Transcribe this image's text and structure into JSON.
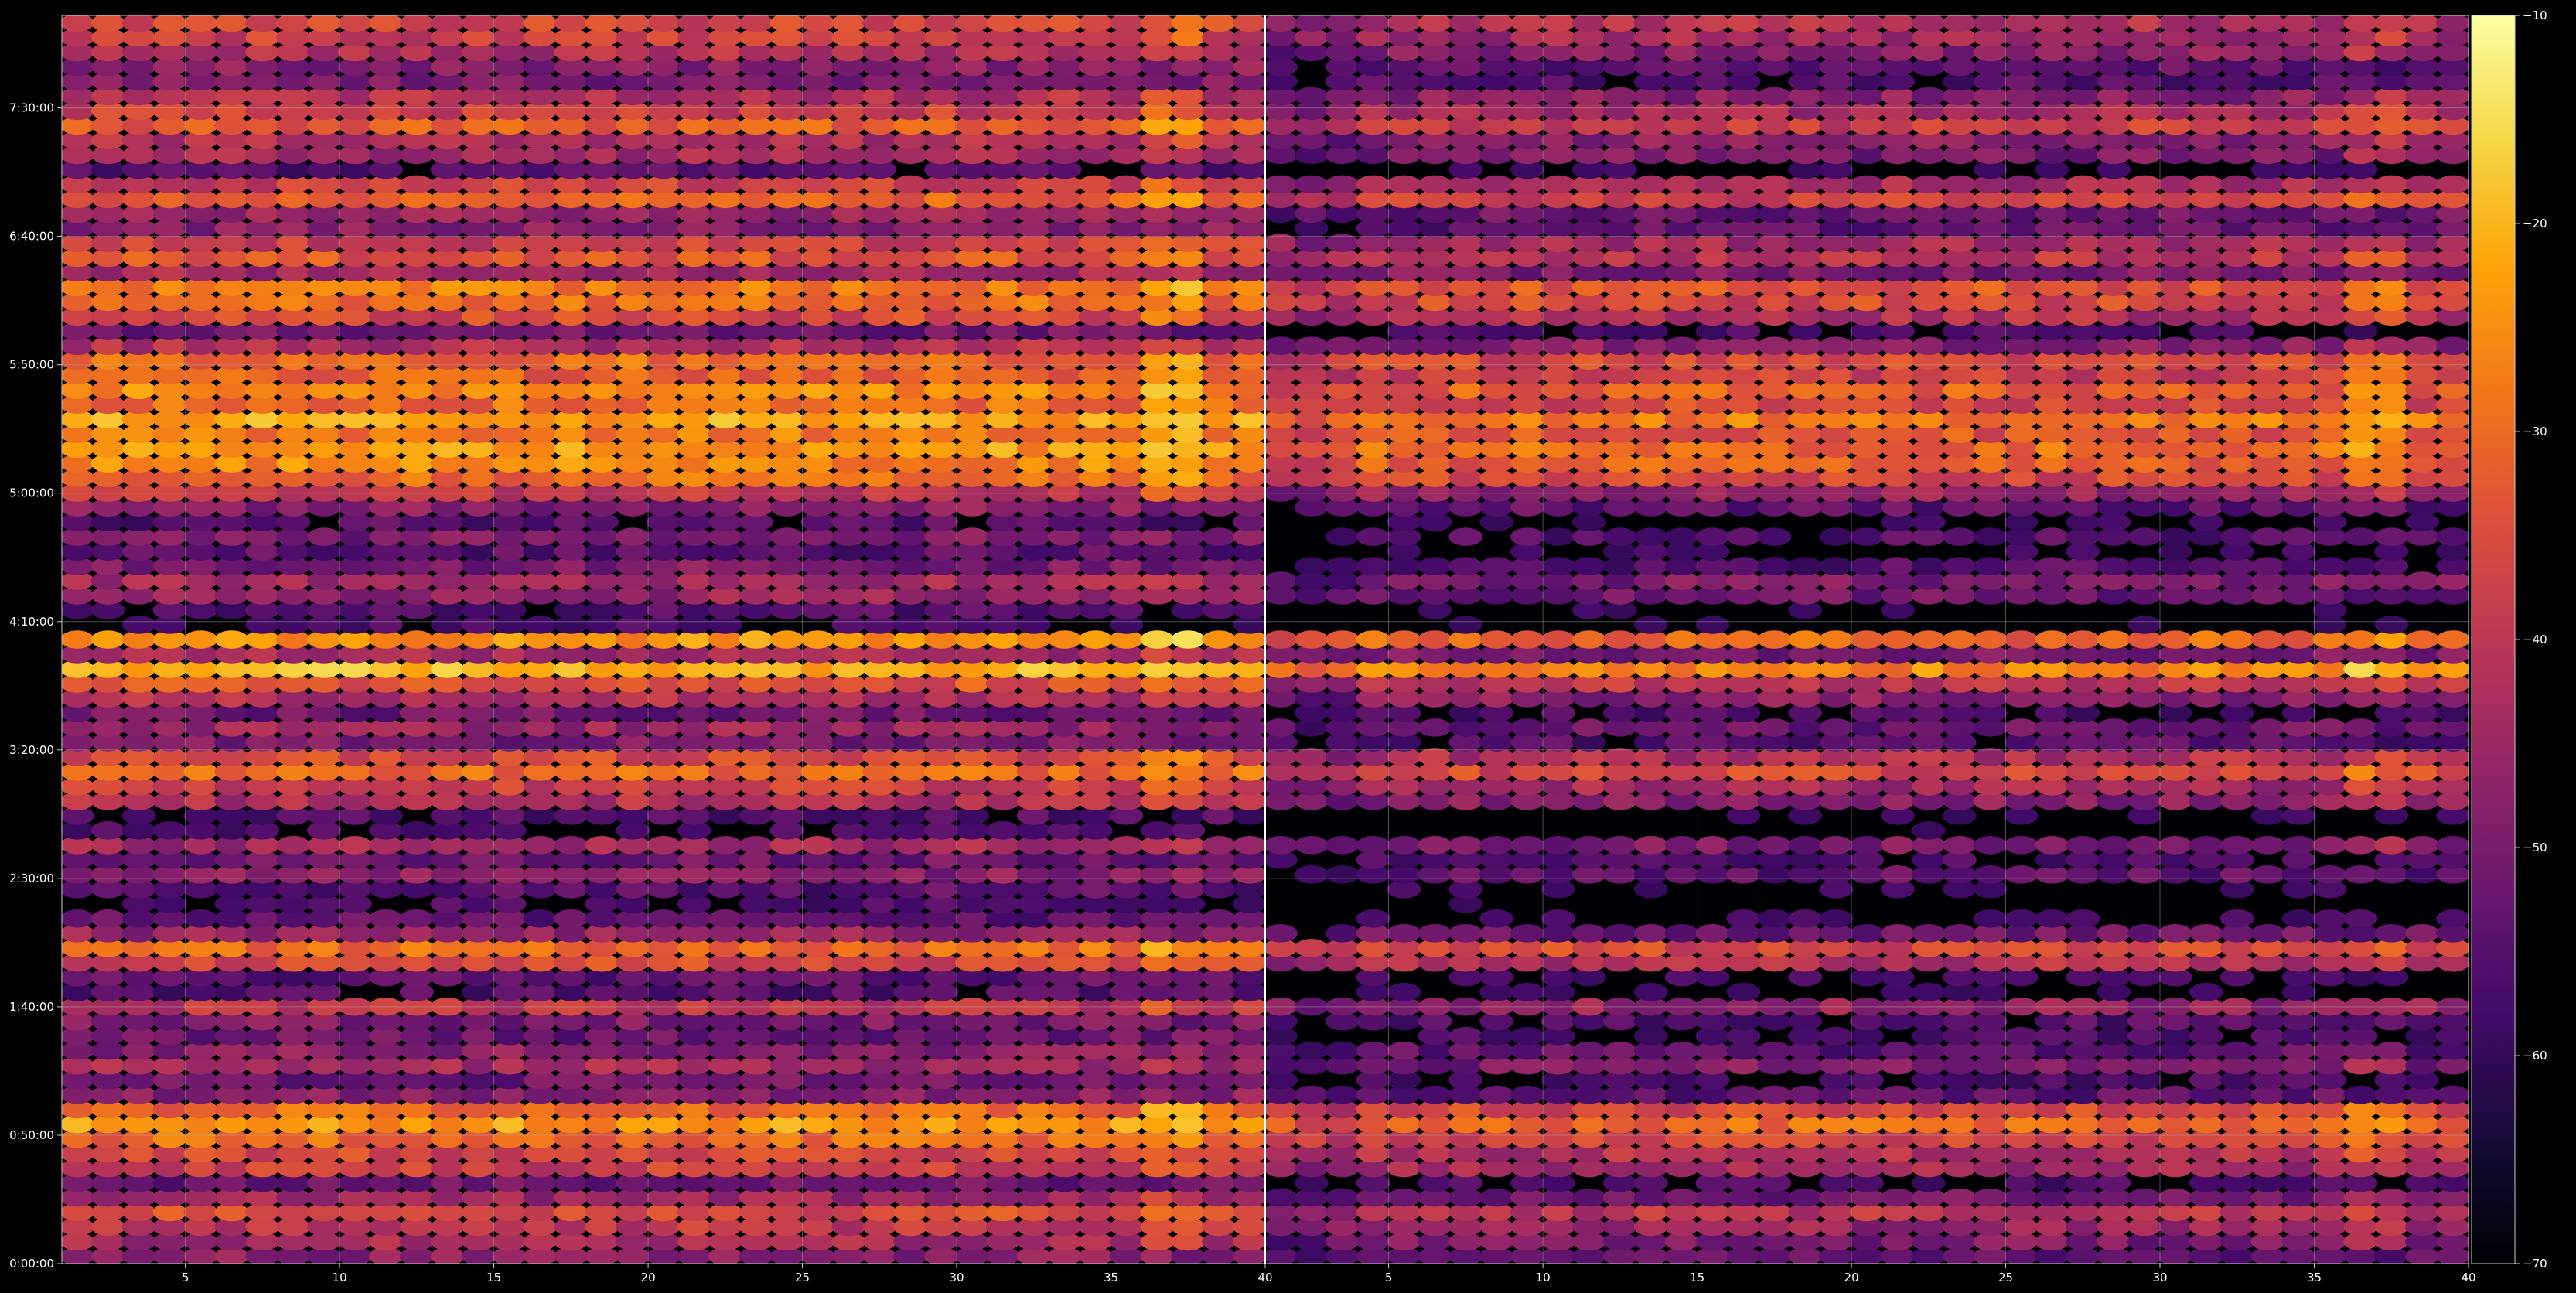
{
  "chart_data": {
    "type": "heatmap",
    "title": "",
    "xlabel": "",
    "ylabel": "",
    "panels": [
      {
        "name": "",
        "xlim": [
          1,
          40
        ],
        "xticks": [
          5,
          10,
          15,
          20,
          25,
          30,
          35,
          40
        ]
      },
      {
        "name": "",
        "xlim": [
          1,
          40
        ],
        "xticks": [
          5,
          10,
          15,
          20,
          25,
          30,
          35,
          40
        ]
      }
    ],
    "y_range_seconds": [
      0,
      29160
    ],
    "yticks": [
      "0:00:00",
      "0:50:00",
      "1:40:00",
      "2:30:00",
      "3:20:00",
      "4:10:00",
      "5:00:00",
      "5:50:00",
      "6:40:00",
      "7:30:00"
    ],
    "color_range": [
      -70,
      -10
    ],
    "colorbar_ticks": [
      "−70",
      "−60",
      "−50",
      "−40",
      "−30",
      "−20",
      "−10"
    ],
    "colormap": "inferno",
    "grid": true,
    "row_interval_seconds": 360,
    "channels": 39,
    "row_profile_db": [
      -48,
      -44,
      -40,
      -35,
      -45,
      -52,
      -38,
      -36,
      -30,
      -24,
      -30,
      -48,
      -52,
      -44,
      -48,
      -52,
      -50,
      -40,
      -56,
      -54,
      -36,
      -30,
      -46,
      -54,
      -58,
      -55,
      -48,
      -52,
      -44,
      -58,
      -56,
      -42,
      -38,
      -30,
      -36,
      -50,
      -46,
      -52,
      -42,
      -34,
      -20,
      -44,
      -25,
      -58,
      -56,
      -46,
      -44,
      -50,
      -55,
      -50,
      -56,
      -48,
      -40,
      -30,
      -26,
      -24,
      -28,
      -22,
      -30,
      -26,
      -32,
      -30,
      -42,
      -52,
      -36,
      -30,
      -28,
      -44,
      -34,
      -38,
      -48,
      -46,
      -32,
      -38,
      -56,
      -44,
      -42,
      -32,
      -38,
      -42,
      -50,
      -48,
      -42,
      -38,
      -36
    ],
    "panel_offset_db": [
      0,
      -6
    ],
    "bright_channels": [
      36,
      37
    ],
    "mean_db": -42,
    "min_db": -70,
    "max_db": -10
  }
}
